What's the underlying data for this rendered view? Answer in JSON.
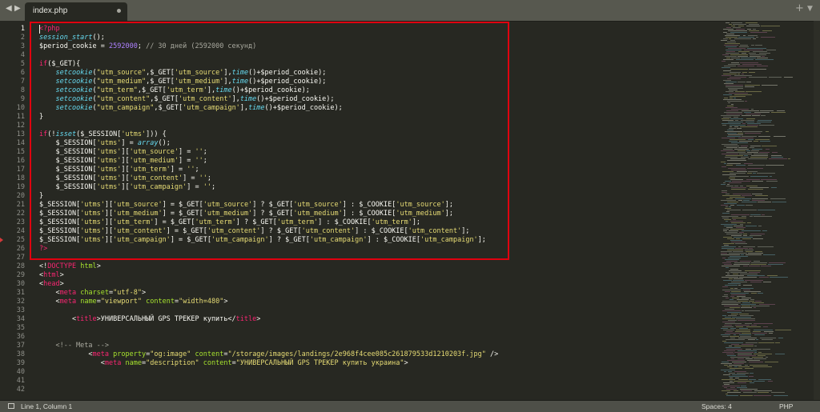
{
  "tab": {
    "label": "index.php"
  },
  "editor": {
    "lines": [
      {
        "n": "1",
        "code": [
          [
            "tag",
            "<?php"
          ]
        ]
      },
      {
        "n": "2",
        "code": [
          [
            "fn",
            "session_start"
          ],
          [
            "var",
            "();"
          ]
        ]
      },
      {
        "n": "3",
        "code": [
          [
            "var",
            "$period_cookie = "
          ],
          [
            "num",
            "2592000"
          ],
          [
            "var",
            "; "
          ],
          [
            "cmt",
            "// 30 дней (2592000 секунд)"
          ]
        ]
      },
      {
        "n": "4",
        "code": []
      },
      {
        "n": "5",
        "code": [
          [
            "kw",
            "if"
          ],
          [
            "var",
            "($_GET){"
          ]
        ]
      },
      {
        "n": "6",
        "code": [
          [
            "var",
            "    "
          ],
          [
            "fn",
            "setcookie"
          ],
          [
            "var",
            "("
          ],
          [
            "str",
            "\"utm_source\""
          ],
          [
            "var",
            ",$_GET["
          ],
          [
            "str",
            "'utm_source'"
          ],
          [
            "var",
            "],"
          ],
          [
            "fn",
            "time"
          ],
          [
            "var",
            "()+$period_cookie);"
          ]
        ]
      },
      {
        "n": "7",
        "code": [
          [
            "var",
            "    "
          ],
          [
            "fn",
            "setcookie"
          ],
          [
            "var",
            "("
          ],
          [
            "str",
            "\"utm_medium\""
          ],
          [
            "var",
            ",$_GET["
          ],
          [
            "str",
            "'utm_medium'"
          ],
          [
            "var",
            "],"
          ],
          [
            "fn",
            "time"
          ],
          [
            "var",
            "()+$period_cookie);"
          ]
        ]
      },
      {
        "n": "8",
        "code": [
          [
            "var",
            "    "
          ],
          [
            "fn",
            "setcookie"
          ],
          [
            "var",
            "("
          ],
          [
            "str",
            "\"utm_term\""
          ],
          [
            "var",
            ",$_GET["
          ],
          [
            "str",
            "'utm_term'"
          ],
          [
            "var",
            "],"
          ],
          [
            "fn",
            "time"
          ],
          [
            "var",
            "()+$period_cookie);"
          ]
        ]
      },
      {
        "n": "9",
        "code": [
          [
            "var",
            "    "
          ],
          [
            "fn",
            "setcookie"
          ],
          [
            "var",
            "("
          ],
          [
            "str",
            "\"utm_content\""
          ],
          [
            "var",
            ",$_GET["
          ],
          [
            "str",
            "'utm_content'"
          ],
          [
            "var",
            "],"
          ],
          [
            "fn",
            "time"
          ],
          [
            "var",
            "()+$period_cookie);"
          ]
        ]
      },
      {
        "n": "10",
        "code": [
          [
            "var",
            "    "
          ],
          [
            "fn",
            "setcookie"
          ],
          [
            "var",
            "("
          ],
          [
            "str",
            "\"utm_campaign\""
          ],
          [
            "var",
            ",$_GET["
          ],
          [
            "str",
            "'utm_campaign'"
          ],
          [
            "var",
            "],"
          ],
          [
            "fn",
            "time"
          ],
          [
            "var",
            "()+$period_cookie);"
          ]
        ]
      },
      {
        "n": "11",
        "code": [
          [
            "var",
            "}"
          ]
        ]
      },
      {
        "n": "12",
        "code": []
      },
      {
        "n": "13",
        "code": [
          [
            "kw",
            "if"
          ],
          [
            "var",
            "(!"
          ],
          [
            "fn",
            "isset"
          ],
          [
            "var",
            "($_SESSION["
          ],
          [
            "str",
            "'utms'"
          ],
          [
            "var",
            "])) {"
          ]
        ]
      },
      {
        "n": "14",
        "code": [
          [
            "var",
            "    $_SESSION["
          ],
          [
            "str",
            "'utms'"
          ],
          [
            "var",
            "] = "
          ],
          [
            "fn",
            "array"
          ],
          [
            "var",
            "();"
          ]
        ]
      },
      {
        "n": "15",
        "code": [
          [
            "var",
            "    $_SESSION["
          ],
          [
            "str",
            "'utms'"
          ],
          [
            "var",
            "]["
          ],
          [
            "str",
            "'utm_source'"
          ],
          [
            "var",
            "] = "
          ],
          [
            "str",
            "''"
          ],
          [
            "var",
            ";"
          ]
        ]
      },
      {
        "n": "16",
        "code": [
          [
            "var",
            "    $_SESSION["
          ],
          [
            "str",
            "'utms'"
          ],
          [
            "var",
            "]["
          ],
          [
            "str",
            "'utm_medium'"
          ],
          [
            "var",
            "] = "
          ],
          [
            "str",
            "''"
          ],
          [
            "var",
            ";"
          ]
        ]
      },
      {
        "n": "17",
        "code": [
          [
            "var",
            "    $_SESSION["
          ],
          [
            "str",
            "'utms'"
          ],
          [
            "var",
            "]["
          ],
          [
            "str",
            "'utm_term'"
          ],
          [
            "var",
            "] = "
          ],
          [
            "str",
            "''"
          ],
          [
            "var",
            ";"
          ]
        ]
      },
      {
        "n": "18",
        "code": [
          [
            "var",
            "    $_SESSION["
          ],
          [
            "str",
            "'utms'"
          ],
          [
            "var",
            "]["
          ],
          [
            "str",
            "'utm_content'"
          ],
          [
            "var",
            "] = "
          ],
          [
            "str",
            "''"
          ],
          [
            "var",
            ";"
          ]
        ]
      },
      {
        "n": "19",
        "code": [
          [
            "var",
            "    $_SESSION["
          ],
          [
            "str",
            "'utms'"
          ],
          [
            "var",
            "]["
          ],
          [
            "str",
            "'utm_campaign'"
          ],
          [
            "var",
            "] = "
          ],
          [
            "str",
            "''"
          ],
          [
            "var",
            ";"
          ]
        ]
      },
      {
        "n": "20",
        "code": [
          [
            "var",
            "}"
          ]
        ]
      },
      {
        "n": "21",
        "code": [
          [
            "var",
            "$_SESSION["
          ],
          [
            "str",
            "'utms'"
          ],
          [
            "var",
            "]["
          ],
          [
            "str",
            "'utm_source'"
          ],
          [
            "var",
            "] = $_GET["
          ],
          [
            "str",
            "'utm_source'"
          ],
          [
            "var",
            "] ? $_GET["
          ],
          [
            "str",
            "'utm_source'"
          ],
          [
            "var",
            "] : $_COOKIE["
          ],
          [
            "str",
            "'utm_source'"
          ],
          [
            "var",
            "];"
          ]
        ]
      },
      {
        "n": "22",
        "code": [
          [
            "var",
            "$_SESSION["
          ],
          [
            "str",
            "'utms'"
          ],
          [
            "var",
            "]["
          ],
          [
            "str",
            "'utm_medium'"
          ],
          [
            "var",
            "] = $_GET["
          ],
          [
            "str",
            "'utm_medium'"
          ],
          [
            "var",
            "] ? $_GET["
          ],
          [
            "str",
            "'utm_medium'"
          ],
          [
            "var",
            "] : $_COOKIE["
          ],
          [
            "str",
            "'utm_medium'"
          ],
          [
            "var",
            "];"
          ]
        ]
      },
      {
        "n": "23",
        "code": [
          [
            "var",
            "$_SESSION["
          ],
          [
            "str",
            "'utms'"
          ],
          [
            "var",
            "]["
          ],
          [
            "str",
            "'utm_term'"
          ],
          [
            "var",
            "] = $_GET["
          ],
          [
            "str",
            "'utm_term'"
          ],
          [
            "var",
            "] ? $_GET["
          ],
          [
            "str",
            "'utm_term'"
          ],
          [
            "var",
            "] : $_COOKIE["
          ],
          [
            "str",
            "'utm_term'"
          ],
          [
            "var",
            "];"
          ]
        ]
      },
      {
        "n": "24",
        "code": [
          [
            "var",
            "$_SESSION["
          ],
          [
            "str",
            "'utms'"
          ],
          [
            "var",
            "]["
          ],
          [
            "str",
            "'utm_content'"
          ],
          [
            "var",
            "] = $_GET["
          ],
          [
            "str",
            "'utm_content'"
          ],
          [
            "var",
            "] ? $_GET["
          ],
          [
            "str",
            "'utm_content'"
          ],
          [
            "var",
            "] : $_COOKIE["
          ],
          [
            "str",
            "'utm_content'"
          ],
          [
            "var",
            "];"
          ]
        ]
      },
      {
        "n": "25",
        "code": [
          [
            "var",
            "$_SESSION["
          ],
          [
            "str",
            "'utms'"
          ],
          [
            "var",
            "]["
          ],
          [
            "str",
            "'utm_campaign'"
          ],
          [
            "var",
            "] = $_GET["
          ],
          [
            "str",
            "'utm_campaign'"
          ],
          [
            "var",
            "] ? $_GET["
          ],
          [
            "str",
            "'utm_campaign'"
          ],
          [
            "var",
            "] : $_COOKIE["
          ],
          [
            "str",
            "'utm_campaign'"
          ],
          [
            "var",
            "];"
          ]
        ]
      },
      {
        "n": "26",
        "code": [
          [
            "tag",
            "?>"
          ]
        ]
      },
      {
        "n": "27",
        "code": []
      },
      {
        "n": "28",
        "code": [
          [
            "var",
            "<!"
          ],
          [
            "kw",
            "DOCTYPE"
          ],
          [
            "var",
            " "
          ],
          [
            "attr",
            "html"
          ],
          [
            "var",
            ">"
          ]
        ]
      },
      {
        "n": "29",
        "code": [
          [
            "var",
            "<"
          ],
          [
            "kw",
            "html"
          ],
          [
            "var",
            ">"
          ]
        ]
      },
      {
        "n": "30",
        "code": [
          [
            "var",
            "<"
          ],
          [
            "kw",
            "head"
          ],
          [
            "var",
            ">"
          ]
        ]
      },
      {
        "n": "31",
        "code": [
          [
            "var",
            "    <"
          ],
          [
            "kw",
            "meta"
          ],
          [
            "var",
            " "
          ],
          [
            "attr",
            "charset"
          ],
          [
            "var",
            "="
          ],
          [
            "str",
            "\"utf-8\""
          ],
          [
            "var",
            ">"
          ]
        ]
      },
      {
        "n": "32",
        "code": [
          [
            "var",
            "    <"
          ],
          [
            "kw",
            "meta"
          ],
          [
            "var",
            " "
          ],
          [
            "attr",
            "name"
          ],
          [
            "var",
            "="
          ],
          [
            "str",
            "\"viewport\""
          ],
          [
            "var",
            " "
          ],
          [
            "attr",
            "content"
          ],
          [
            "var",
            "="
          ],
          [
            "str",
            "\"width=480\""
          ],
          [
            "var",
            ">"
          ]
        ]
      },
      {
        "n": "33",
        "code": []
      },
      {
        "n": "34",
        "code": [
          [
            "var",
            "        <"
          ],
          [
            "kw",
            "title"
          ],
          [
            "var",
            ">УНИВЕРСАЛЬНЫЙ GPS ТРЕКЕР купить</"
          ],
          [
            "kw",
            "title"
          ],
          [
            "var",
            ">"
          ]
        ]
      },
      {
        "n": "35",
        "code": []
      },
      {
        "n": "36",
        "code": []
      },
      {
        "n": "37",
        "code": [
          [
            "cmt",
            "    <!-- Meta -->"
          ]
        ]
      },
      {
        "n": "38",
        "code": [
          [
            "var",
            "            <"
          ],
          [
            "kw",
            "meta"
          ],
          [
            "var",
            " "
          ],
          [
            "attr",
            "property"
          ],
          [
            "var",
            "="
          ],
          [
            "str",
            "\"og:image\""
          ],
          [
            "var",
            " "
          ],
          [
            "attr",
            "content"
          ],
          [
            "var",
            "="
          ],
          [
            "str",
            "\"/storage/images/landings/2e968f4cee085c261879533d1210203f.jpg\""
          ],
          [
            "var",
            " />"
          ]
        ]
      },
      {
        "n": "39",
        "code": [
          [
            "var",
            "               <"
          ],
          [
            "kw",
            "meta"
          ],
          [
            "var",
            " "
          ],
          [
            "attr",
            "name"
          ],
          [
            "var",
            "="
          ],
          [
            "str",
            "\"description\""
          ],
          [
            "var",
            " "
          ],
          [
            "attr",
            "content"
          ],
          [
            "var",
            "="
          ],
          [
            "str",
            "\"УНИВЕРСАЛЬНЫЙ GPS ТРЕКЕР купить украина\""
          ],
          [
            "var",
            ">"
          ]
        ]
      },
      {
        "n": "40",
        "code": []
      },
      {
        "n": "41",
        "code": []
      },
      {
        "n": "42",
        "code": []
      }
    ]
  },
  "status": {
    "position": "Line 1, Column 1",
    "spaces": "Spaces: 4",
    "syntax": "PHP"
  },
  "icons": {
    "back": "arrow-left-icon",
    "forward": "arrow-right-icon",
    "new_tab": "plus-icon",
    "tab_menu": "chevron-down-icon",
    "status": "panel-icon"
  },
  "colors": {
    "background": "#272822",
    "tabbar": "#57584f",
    "statusbar": "#4e4f48",
    "highlight_box": "#e0000f",
    "string": "#e6db74",
    "keyword": "#f92672",
    "function": "#66d9ef",
    "number": "#ae81ff",
    "attribute": "#a6e22e"
  }
}
